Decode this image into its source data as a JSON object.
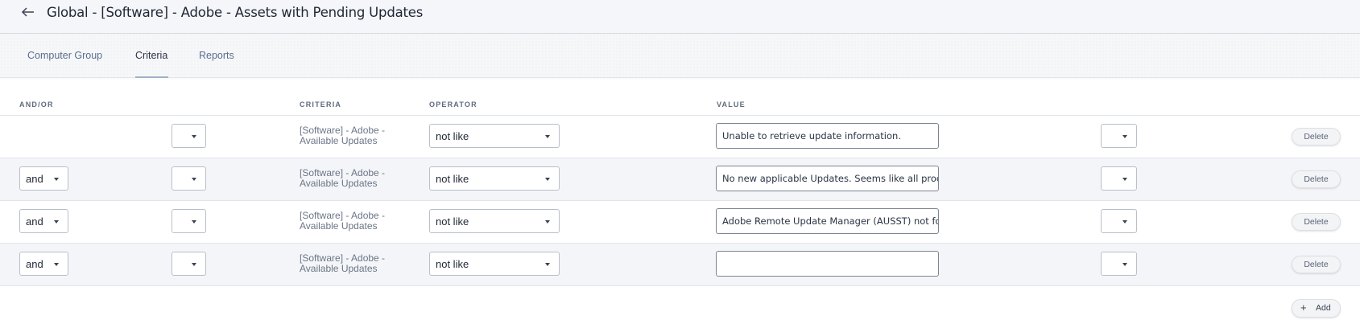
{
  "header": {
    "title": "Global - [Software] - Adobe - Assets with Pending Updates"
  },
  "tabs": [
    {
      "label": "Computer Group",
      "active": false
    },
    {
      "label": "Criteria",
      "active": true
    },
    {
      "label": "Reports",
      "active": false
    }
  ],
  "columns": {
    "andor": "AND/OR",
    "criteria": "CRITERIA",
    "operator": "OPERATOR",
    "value": "VALUE"
  },
  "rows": [
    {
      "andor": "",
      "open_paren": "",
      "criteria": "[Software] - Adobe - Available Updates",
      "operator": "not like",
      "value": "Unable to retrieve update information.",
      "close_paren": "",
      "delete_label": "Delete"
    },
    {
      "andor": "and",
      "open_paren": "",
      "criteria": "[Software] - Adobe - Available Updates",
      "operator": "not like",
      "value": "No new applicable Updates. Seems like all proc",
      "close_paren": "",
      "delete_label": "Delete"
    },
    {
      "andor": "and",
      "open_paren": "",
      "criteria": "[Software] - Adobe - Available Updates",
      "operator": "not like",
      "value": "Adobe Remote Update Manager (AUSST) not fo",
      "close_paren": "",
      "delete_label": "Delete"
    },
    {
      "andor": "and",
      "open_paren": "",
      "criteria": "[Software] - Adobe - Available Updates",
      "operator": "not like",
      "value": "",
      "close_paren": "",
      "delete_label": "Delete"
    }
  ],
  "actions": {
    "add_label": "Add"
  },
  "colors": {
    "accent_underline": "#9fb1c8",
    "tab_inactive": "#5a6f8e",
    "row_alt": "#f4f5f8"
  }
}
